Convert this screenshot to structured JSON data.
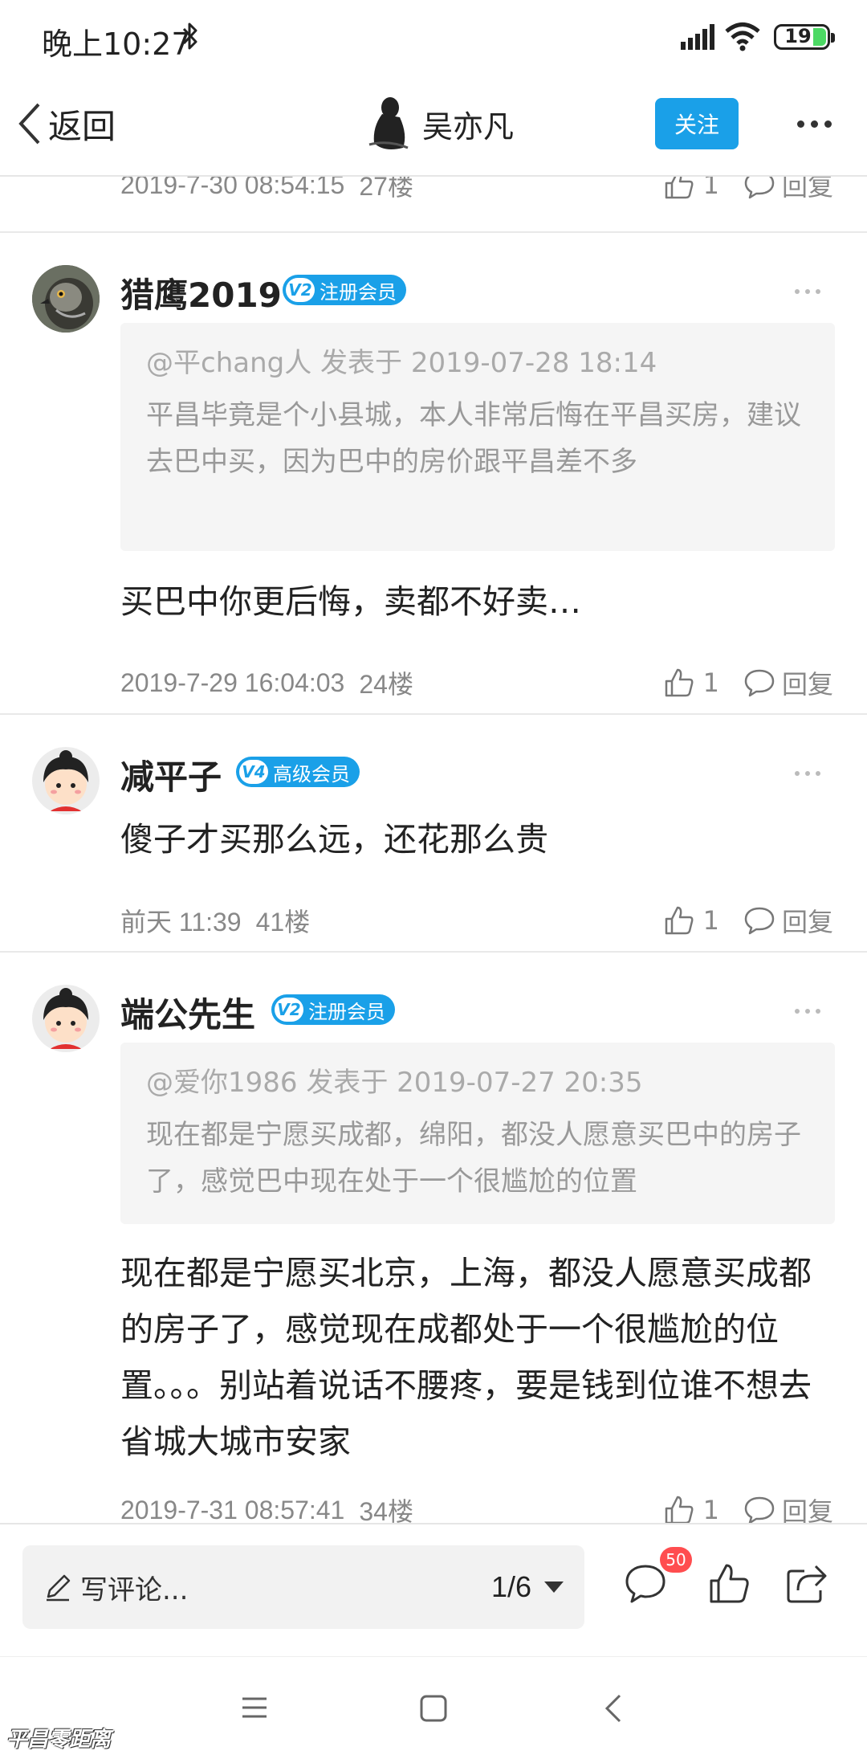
{
  "status": {
    "time": "晚上10:27",
    "battery": "19"
  },
  "nav": {
    "back_label": "返回",
    "author": "吴亦凡",
    "follow_label": "关注"
  },
  "top_partial": {
    "time": "2019-7-30 08:54:15",
    "floor": "27楼",
    "likes": "1",
    "reply": "回复"
  },
  "posts": [
    {
      "username": "猎鹰2019",
      "badge_level": "V2",
      "badge_text": "注册会员",
      "quote_head": "@平chang人 发表于 2019-07-28 18:14",
      "quote_body": "平昌毕竟是个小县城，本人非常后悔在平昌买房，建议去巴中买，因为巴中的房价跟平昌差不多",
      "comment": "买巴中你更后悔，卖都不好卖…",
      "time": "2019-7-29 16:04:03",
      "floor": "24楼",
      "likes": "1",
      "reply": "回复"
    },
    {
      "username": "减平子",
      "badge_level": "V4",
      "badge_text": "高级会员",
      "comment": "傻子才买那么远，还花那么贵",
      "time": "前天 11:39",
      "floor": "41楼",
      "likes": "1",
      "reply": "回复"
    },
    {
      "username": "端公先生",
      "badge_level": "V2",
      "badge_text": "注册会员",
      "quote_head": "@爱你1986 发表于 2019-07-27 20:35",
      "quote_body": "现在都是宁愿买成都，绵阳，都没人愿意买巴中的房子了，感觉巴中现在处于一个很尴尬的位置",
      "comment": "现在都是宁愿买北京，上海，都没人愿意买成都的房子了，感觉现在成都处于一个很尴尬的位置。。。别站着说话不腰疼，要是钱到位谁不想去省城大城市安家",
      "time": "2019-7-31 08:57:41",
      "floor": "34楼",
      "likes": "1",
      "reply": "回复"
    }
  ],
  "bottom": {
    "placeholder": "写评论...",
    "page": "1/6",
    "comment_count": "50"
  },
  "watermark": "平昌零距离",
  "colors": {
    "accent": "#1aa0e8",
    "badge_red": "#ff4d4f"
  },
  "icons": [
    "bluetooth-icon",
    "signal-icon",
    "wifi-icon",
    "battery-icon",
    "back-icon",
    "more-icon",
    "like-icon",
    "reply-icon",
    "pencil-icon",
    "comment-icon",
    "share-icon",
    "menu-icon",
    "home-icon"
  ]
}
